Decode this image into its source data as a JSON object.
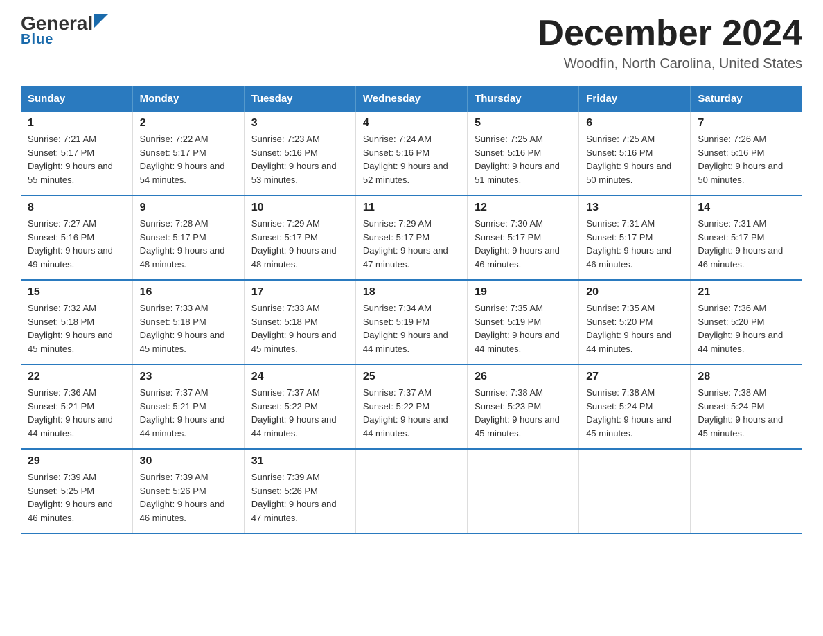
{
  "header": {
    "logo_general": "General",
    "logo_blue": "Blue",
    "month_title": "December 2024",
    "location": "Woodfin, North Carolina, United States"
  },
  "days_of_week": [
    "Sunday",
    "Monday",
    "Tuesday",
    "Wednesday",
    "Thursday",
    "Friday",
    "Saturday"
  ],
  "weeks": [
    [
      {
        "day": "1",
        "sunrise": "7:21 AM",
        "sunset": "5:17 PM",
        "daylight": "9 hours and 55 minutes."
      },
      {
        "day": "2",
        "sunrise": "7:22 AM",
        "sunset": "5:17 PM",
        "daylight": "9 hours and 54 minutes."
      },
      {
        "day": "3",
        "sunrise": "7:23 AM",
        "sunset": "5:16 PM",
        "daylight": "9 hours and 53 minutes."
      },
      {
        "day": "4",
        "sunrise": "7:24 AM",
        "sunset": "5:16 PM",
        "daylight": "9 hours and 52 minutes."
      },
      {
        "day": "5",
        "sunrise": "7:25 AM",
        "sunset": "5:16 PM",
        "daylight": "9 hours and 51 minutes."
      },
      {
        "day": "6",
        "sunrise": "7:25 AM",
        "sunset": "5:16 PM",
        "daylight": "9 hours and 50 minutes."
      },
      {
        "day": "7",
        "sunrise": "7:26 AM",
        "sunset": "5:16 PM",
        "daylight": "9 hours and 50 minutes."
      }
    ],
    [
      {
        "day": "8",
        "sunrise": "7:27 AM",
        "sunset": "5:16 PM",
        "daylight": "9 hours and 49 minutes."
      },
      {
        "day": "9",
        "sunrise": "7:28 AM",
        "sunset": "5:17 PM",
        "daylight": "9 hours and 48 minutes."
      },
      {
        "day": "10",
        "sunrise": "7:29 AM",
        "sunset": "5:17 PM",
        "daylight": "9 hours and 48 minutes."
      },
      {
        "day": "11",
        "sunrise": "7:29 AM",
        "sunset": "5:17 PM",
        "daylight": "9 hours and 47 minutes."
      },
      {
        "day": "12",
        "sunrise": "7:30 AM",
        "sunset": "5:17 PM",
        "daylight": "9 hours and 46 minutes."
      },
      {
        "day": "13",
        "sunrise": "7:31 AM",
        "sunset": "5:17 PM",
        "daylight": "9 hours and 46 minutes."
      },
      {
        "day": "14",
        "sunrise": "7:31 AM",
        "sunset": "5:17 PM",
        "daylight": "9 hours and 46 minutes."
      }
    ],
    [
      {
        "day": "15",
        "sunrise": "7:32 AM",
        "sunset": "5:18 PM",
        "daylight": "9 hours and 45 minutes."
      },
      {
        "day": "16",
        "sunrise": "7:33 AM",
        "sunset": "5:18 PM",
        "daylight": "9 hours and 45 minutes."
      },
      {
        "day": "17",
        "sunrise": "7:33 AM",
        "sunset": "5:18 PM",
        "daylight": "9 hours and 45 minutes."
      },
      {
        "day": "18",
        "sunrise": "7:34 AM",
        "sunset": "5:19 PM",
        "daylight": "9 hours and 44 minutes."
      },
      {
        "day": "19",
        "sunrise": "7:35 AM",
        "sunset": "5:19 PM",
        "daylight": "9 hours and 44 minutes."
      },
      {
        "day": "20",
        "sunrise": "7:35 AM",
        "sunset": "5:20 PM",
        "daylight": "9 hours and 44 minutes."
      },
      {
        "day": "21",
        "sunrise": "7:36 AM",
        "sunset": "5:20 PM",
        "daylight": "9 hours and 44 minutes."
      }
    ],
    [
      {
        "day": "22",
        "sunrise": "7:36 AM",
        "sunset": "5:21 PM",
        "daylight": "9 hours and 44 minutes."
      },
      {
        "day": "23",
        "sunrise": "7:37 AM",
        "sunset": "5:21 PM",
        "daylight": "9 hours and 44 minutes."
      },
      {
        "day": "24",
        "sunrise": "7:37 AM",
        "sunset": "5:22 PM",
        "daylight": "9 hours and 44 minutes."
      },
      {
        "day": "25",
        "sunrise": "7:37 AM",
        "sunset": "5:22 PM",
        "daylight": "9 hours and 44 minutes."
      },
      {
        "day": "26",
        "sunrise": "7:38 AM",
        "sunset": "5:23 PM",
        "daylight": "9 hours and 45 minutes."
      },
      {
        "day": "27",
        "sunrise": "7:38 AM",
        "sunset": "5:24 PM",
        "daylight": "9 hours and 45 minutes."
      },
      {
        "day": "28",
        "sunrise": "7:38 AM",
        "sunset": "5:24 PM",
        "daylight": "9 hours and 45 minutes."
      }
    ],
    [
      {
        "day": "29",
        "sunrise": "7:39 AM",
        "sunset": "5:25 PM",
        "daylight": "9 hours and 46 minutes."
      },
      {
        "day": "30",
        "sunrise": "7:39 AM",
        "sunset": "5:26 PM",
        "daylight": "9 hours and 46 minutes."
      },
      {
        "day": "31",
        "sunrise": "7:39 AM",
        "sunset": "5:26 PM",
        "daylight": "9 hours and 47 minutes."
      },
      null,
      null,
      null,
      null
    ]
  ],
  "labels": {
    "sunrise": "Sunrise:",
    "sunset": "Sunset:",
    "daylight": "Daylight:"
  }
}
